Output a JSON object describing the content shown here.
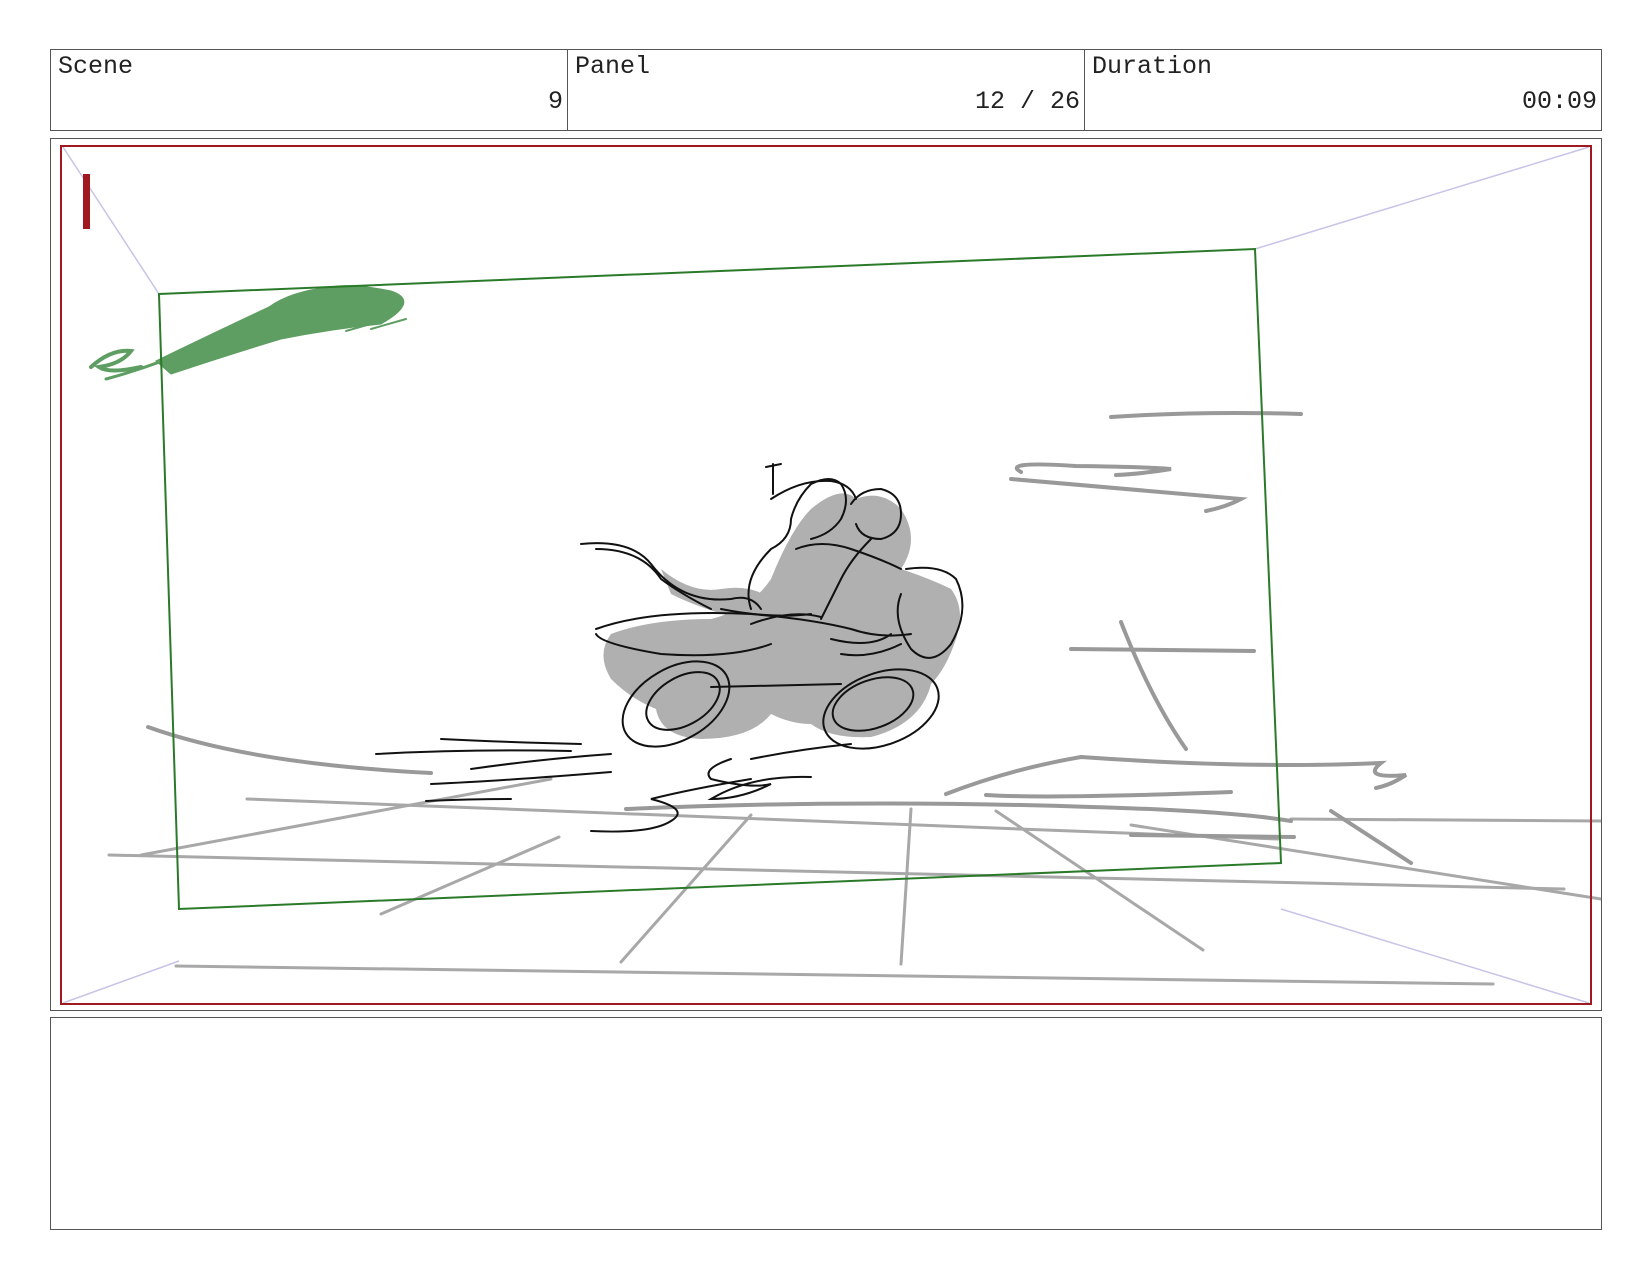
{
  "header": {
    "scene": {
      "label": "Scene",
      "value": "9"
    },
    "panel": {
      "label": "Panel",
      "value": "12 / 26"
    },
    "duration": {
      "label": "Duration",
      "value": "00:09"
    }
  },
  "colors": {
    "safe_frame": "#a01820",
    "camera_frame": "#2a7a2a",
    "perspective_guides": "#c8c4e8",
    "sketch_fill": "#b0b0b0",
    "background_lines": "#a8a8a8",
    "ink": "#111111",
    "flying_creature": "#5e9e62"
  },
  "notes": {
    "text": ""
  }
}
